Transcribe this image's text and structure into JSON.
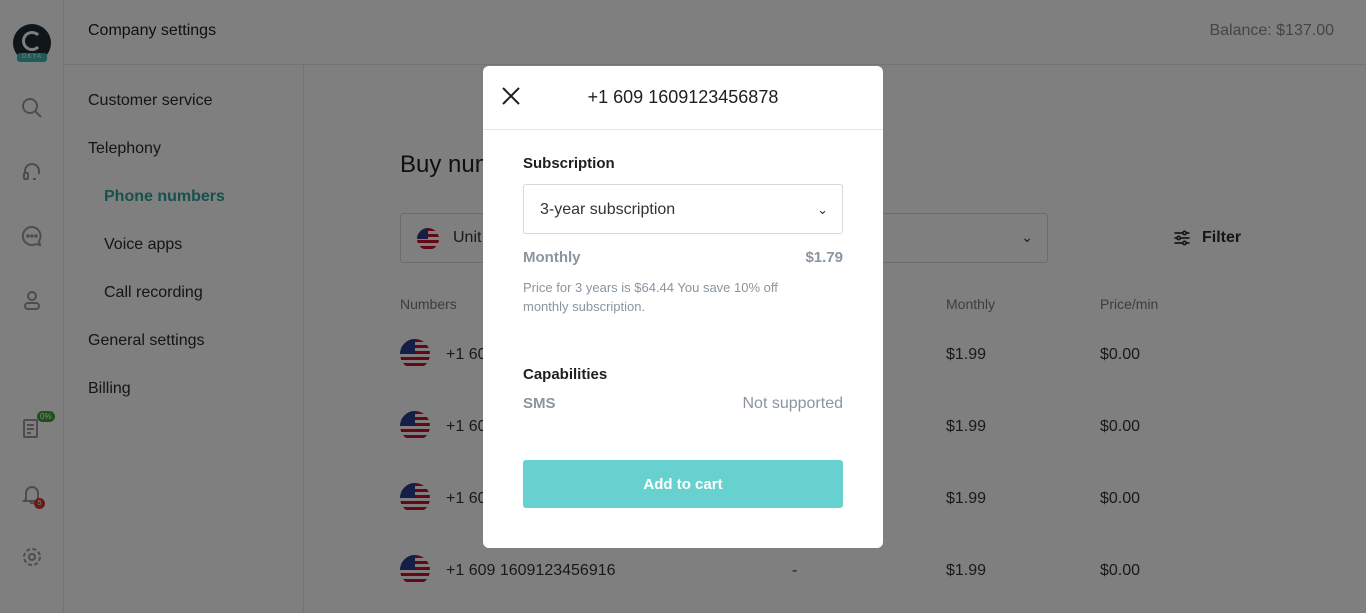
{
  "header": {
    "title": "Company settings",
    "balance_label": "Balance:",
    "balance_value": "$137.00"
  },
  "rail": {
    "logo_tag": "OKYA",
    "progress_badge": "0%",
    "notification_count": "5",
    "icons": [
      "search-icon",
      "headset-icon",
      "chat-icon",
      "user-icon",
      "invoice-icon",
      "bell-icon",
      "gear-icon"
    ]
  },
  "settings_nav": {
    "customer_service": "Customer service",
    "telephony": "Telephony",
    "phone_numbers": "Phone numbers",
    "voice_apps": "Voice apps",
    "call_recording": "Call recording",
    "general_settings": "General settings",
    "billing": "Billing"
  },
  "main": {
    "heading": "Buy num",
    "country_value": "Unit",
    "filter_label": "Filter",
    "columns": {
      "numbers": "Numbers",
      "monthly": "Monthly",
      "price_min": "Price/min"
    },
    "rows": [
      {
        "number": "+1 60",
        "extra": "",
        "monthly": "$1.99",
        "price_min": "$0.00"
      },
      {
        "number": "+1 60",
        "extra": "",
        "monthly": "$1.99",
        "price_min": "$0.00"
      },
      {
        "number": "+1 60",
        "extra": "",
        "monthly": "$1.99",
        "price_min": "$0.00"
      },
      {
        "number": "+1 609 1609123456916",
        "extra": "-",
        "monthly": "$1.99",
        "price_min": "$0.00"
      }
    ]
  },
  "modal": {
    "title": "+1 609 1609123456878",
    "subscription_label": "Subscription",
    "subscription_value": "3-year subscription",
    "monthly_label": "Monthly",
    "monthly_value": "$1.79",
    "note": "Price for 3 years is $64.44 You save 10% off monthly subscription.",
    "capabilities_label": "Capabilities",
    "sms_label": "SMS",
    "sms_value": "Not supported",
    "add_to_cart": "Add to cart"
  },
  "colors": {
    "accent": "#2aa39b",
    "button": "#67d1d0",
    "muted": "#8a95a0"
  }
}
